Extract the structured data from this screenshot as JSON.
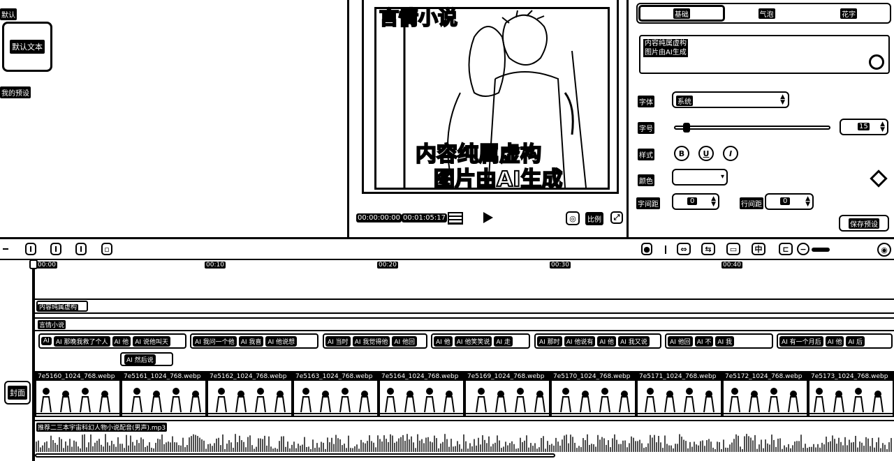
{
  "presets": {
    "default_label": "默认",
    "default_text": "默认文本",
    "my_presets": "我的预设"
  },
  "preview": {
    "overlay_title": "言情小说",
    "subtitle_line1": "内容纯属虚构",
    "subtitle_line2": "图片由AI生成",
    "time_current": "00:00:00:00",
    "time_total": "00:01:05:17",
    "ratio_label": "比例"
  },
  "props": {
    "tabs": [
      "基础",
      "气泡",
      "花字"
    ],
    "text_content": "内容纯属虚构\n图片由AI生成",
    "font_label": "字体",
    "font_value": "系统",
    "size_label": "字号",
    "size_value": "15",
    "size_fraction": 0.05,
    "style_label": "样式",
    "style_buttons": [
      "B",
      "U",
      "I"
    ],
    "color_label": "颜色",
    "letter_spacing_label": "字间距",
    "letter_spacing_value": "0",
    "line_spacing_label": "行间距",
    "line_spacing_value": "0",
    "save_preset": "保存预设"
  },
  "timeline": {
    "ruler": [
      "00:00",
      "00:10",
      "00:20",
      "00:30",
      "00:40"
    ],
    "text_track_clip": "内容纯属虚构",
    "caption_track_label": "言情小说",
    "cover_label": "封面",
    "subtitle_clips": [
      [
        "AI",
        "AI 那晚我救了个人",
        "AI 他",
        "AI 说他叫天"
      ],
      [
        "AI 我问一个他",
        "AI 我喜",
        "AI 他说想"
      ],
      [
        "AI 当时",
        "AI 我觉得他",
        "AI 他回"
      ],
      [
        "AI 他",
        "AI 他笑笑说",
        "AI 走"
      ],
      [
        "AI 那时",
        "AI 他说有",
        "AI 他",
        "AI 我又说"
      ],
      [
        "AI 他回",
        "AI 不",
        "AI 我"
      ],
      [
        "AI 有一个月后",
        "AI 他",
        "AI 后"
      ]
    ],
    "sub_clip_extra": "AI 然后说",
    "frames": [
      "7e5160_1024_768.webp",
      "7e5161_1024_768.webp",
      "7e5162_1024_768.webp",
      "7e5163_1024_768.webp",
      "7e5164_1024_768.webp",
      "7e5169_1024_768.webp",
      "7e5170_1024_768.webp",
      "7e5171_1024_768.webp",
      "7e5172_1024_768.webp",
      "7e5173_1024_768.webp"
    ],
    "audio_label": "推荐二三本宇宙科幻人物小说配音(男声).mp3"
  }
}
